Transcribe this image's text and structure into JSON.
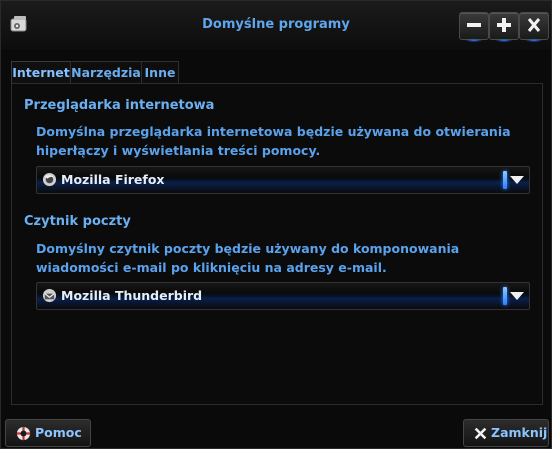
{
  "window": {
    "title": "Domyślne programy"
  },
  "titlebar_buttons": {
    "minimize": "minimize-icon",
    "maximize": "maximize-icon",
    "close": "close-icon"
  },
  "tabs": [
    {
      "label": "Internet",
      "active": true
    },
    {
      "label": "Narzędzia",
      "active": false
    },
    {
      "label": "Inne",
      "active": false
    }
  ],
  "browser": {
    "title": "Przeglądarka internetowa",
    "description": "Domyślna przeglądarka internetowa będzie używana do otwierania hiperłączy i wyświetlania treści pomocy.",
    "selected": "Mozilla Firefox",
    "icon": "firefox-icon"
  },
  "mail": {
    "title": "Czytnik poczty",
    "description": "Domyślny czytnik poczty będzie używany do komponowania wiadomości e-mail po kliknięciu na adresy e-mail.",
    "selected": "Mozilla Thunderbird",
    "icon": "thunderbird-icon"
  },
  "footer": {
    "help_label": "Pomoc",
    "close_label": "Zamknij"
  },
  "colors": {
    "accent": "#5aa0e6",
    "background": "#0a0a0a",
    "glow": "#2d7fff"
  }
}
